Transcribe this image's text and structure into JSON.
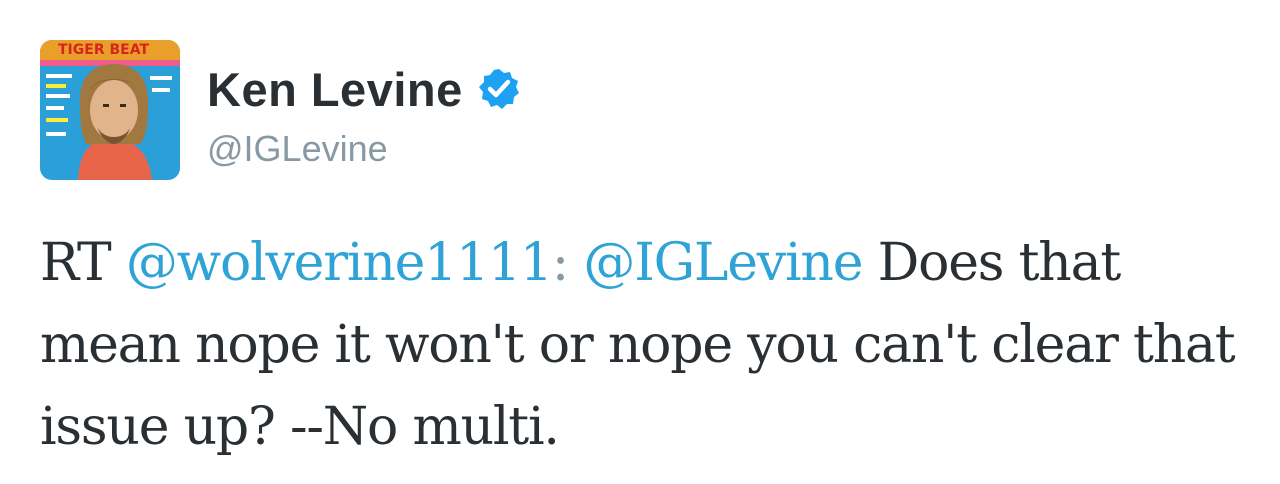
{
  "author": {
    "display_name": "Ken Levine",
    "handle": "@IGLevine",
    "verified": true,
    "avatar_magazine_text": "TIGER BEAT",
    "verified_icon": "verified-badge-icon"
  },
  "tweet": {
    "prefix": "RT ",
    "mention_1": "@wolverine1111",
    "separator": ":",
    "space_after_separator": " ",
    "mention_2": "@IGLevine",
    "text": " Does that mean nope it won't or nope you can't clear that issue up? --No multi."
  },
  "colors": {
    "link": "#2fa3d6",
    "verified": "#1da1f2",
    "text": "#292f33",
    "muted": "#8899a6"
  }
}
